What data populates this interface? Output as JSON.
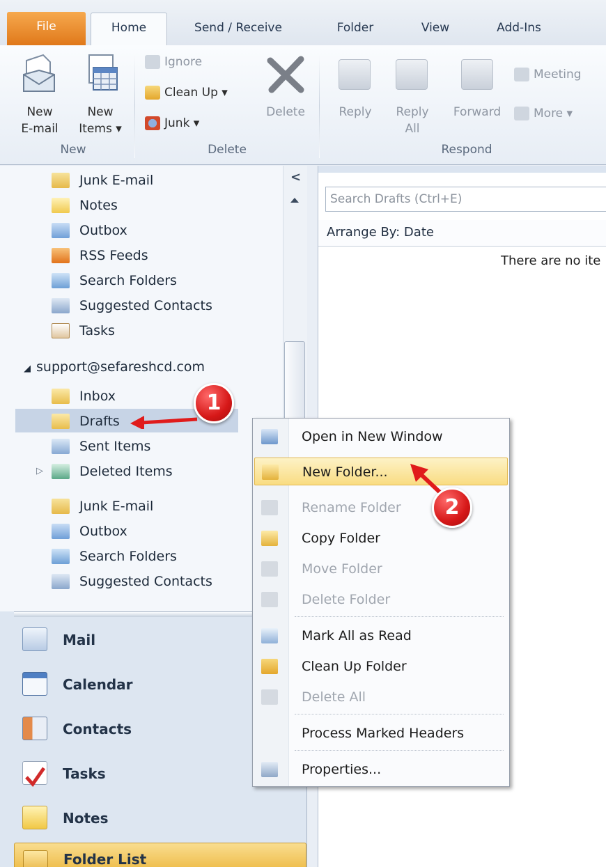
{
  "ribbon": {
    "tabs": [
      "File",
      "Home",
      "Send / Receive",
      "Folder",
      "View",
      "Add-Ins"
    ],
    "new_group": {
      "label": "New",
      "new_email": "New\nE-mail",
      "new_items": "New\nItems ▾"
    },
    "delete_group": {
      "label": "Delete",
      "ignore": "Ignore",
      "clean_up": "Clean Up ▾",
      "junk": "Junk ▾",
      "delete": "Delete"
    },
    "respond_group": {
      "label": "Respond",
      "reply": "Reply",
      "reply_all": "Reply\nAll",
      "forward": "Forward",
      "meeting": "Meeting",
      "more": "More ▾"
    }
  },
  "nav": {
    "collapse_glyph": "<",
    "folders_top": [
      "Junk E-mail",
      "Notes",
      "Outbox",
      "RSS Feeds",
      "Search Folders",
      "Suggested Contacts",
      "Tasks"
    ],
    "account": "support@sefareshcd.com",
    "account_folders": [
      "Inbox",
      "Drafts",
      "Sent Items",
      "Deleted Items",
      "Junk E-mail",
      "Outbox",
      "Search Folders",
      "Suggested Contacts"
    ],
    "selected_folder": "Drafts",
    "modules": [
      "Mail",
      "Calendar",
      "Contacts",
      "Tasks",
      "Notes",
      "Folder List"
    ]
  },
  "content": {
    "search_placeholder": "Search Drafts (Ctrl+E)",
    "arrange_by": "Arrange By: Date",
    "empty_message": "There are no ite"
  },
  "context_menu": {
    "items": [
      {
        "label": "Open in New Window",
        "enabled": true
      },
      {
        "label": "New Folder...",
        "enabled": true,
        "highlighted": true
      },
      {
        "label": "Rename Folder",
        "enabled": false
      },
      {
        "label": "Copy Folder",
        "enabled": true
      },
      {
        "label": "Move Folder",
        "enabled": false
      },
      {
        "label": "Delete Folder",
        "enabled": false
      },
      {
        "label": "Mark All as Read",
        "enabled": true
      },
      {
        "label": "Clean Up Folder",
        "enabled": true
      },
      {
        "label": "Delete All",
        "enabled": false
      },
      {
        "label": "Process Marked Headers",
        "enabled": true
      },
      {
        "label": "Properties...",
        "enabled": true
      }
    ]
  },
  "annotations": {
    "step1": "1",
    "step2": "2"
  },
  "colors": {
    "file_tab": "#e0781a",
    "highlight": "#f9dc82",
    "annotation_red": "#d61818",
    "selection": "#c7d4e6"
  }
}
